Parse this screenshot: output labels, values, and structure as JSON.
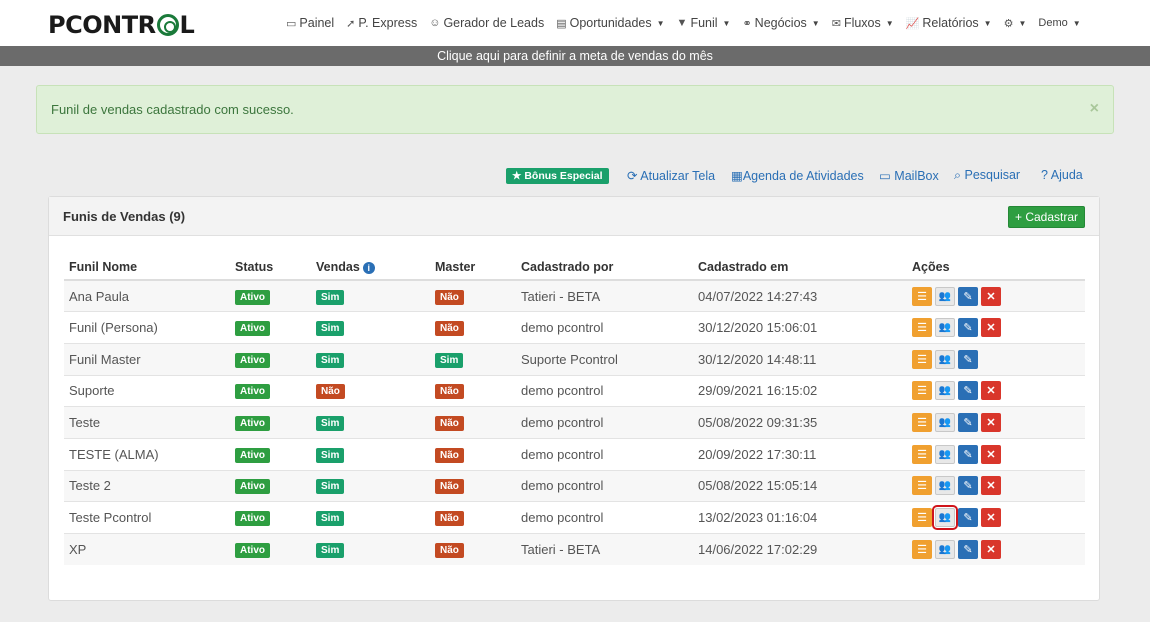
{
  "app": {
    "logo": "PCONTROL"
  },
  "nav": [
    {
      "label": "Painel",
      "icon": "monitor-icon",
      "caret": false
    },
    {
      "label": "P. Express",
      "icon": "rocket-icon",
      "caret": false
    },
    {
      "label": "Gerador de Leads",
      "icon": "robot-icon",
      "caret": false
    },
    {
      "label": "Oportunidades",
      "icon": "list-icon",
      "caret": true
    },
    {
      "label": "Funil",
      "icon": "filter-icon",
      "caret": true
    },
    {
      "label": "Negócios",
      "icon": "handshake-icon",
      "caret": true
    },
    {
      "label": "Fluxos",
      "icon": "envelope-icon",
      "caret": true
    },
    {
      "label": "Relatórios",
      "icon": "chart-icon",
      "caret": true
    }
  ],
  "user": {
    "label": "Demo"
  },
  "goal_bar": "Clique aqui para definir a meta de vendas do mês",
  "alert": {
    "message": "Funil de vendas cadastrado com sucesso.",
    "close": "×"
  },
  "quick_links": {
    "bonus": "Bônus Especial",
    "refresh": "Atualizar Tela",
    "agenda": "Agenda de Atividades",
    "mailbox": "MailBox",
    "search": "Pesquisar",
    "help": "Ajuda"
  },
  "panel": {
    "title": "Funis de Vendas (9)",
    "add_button": "Cadastrar"
  },
  "table": {
    "headers": [
      "Funil Nome",
      "Status",
      "Vendas",
      "Master",
      "Cadastrado por",
      "Cadastrado em",
      "Ações"
    ],
    "rows": [
      {
        "name": "Ana Paula",
        "status": "Ativo",
        "vendas": "Sim",
        "master": "Não",
        "by": "Tatieri - BETA",
        "at": "04/07/2022 14:27:43",
        "deletable": true
      },
      {
        "name": "Funil (Persona)",
        "status": "Ativo",
        "vendas": "Sim",
        "master": "Não",
        "by": "demo pcontrol",
        "at": "30/12/2020 15:06:01",
        "deletable": true
      },
      {
        "name": "Funil Master",
        "status": "Ativo",
        "vendas": "Sim",
        "master": "Sim",
        "by": "Suporte Pcontrol",
        "at": "30/12/2020 14:48:11",
        "deletable": false
      },
      {
        "name": "Suporte",
        "status": "Ativo",
        "vendas": "Não",
        "master": "Não",
        "by": "demo pcontrol",
        "at": "29/09/2021 16:15:02",
        "deletable": true
      },
      {
        "name": "Teste",
        "status": "Ativo",
        "vendas": "Sim",
        "master": "Não",
        "by": "demo pcontrol",
        "at": "05/08/2022 09:31:35",
        "deletable": true
      },
      {
        "name": "TESTE (ALMA)",
        "status": "Ativo",
        "vendas": "Sim",
        "master": "Não",
        "by": "demo pcontrol",
        "at": "20/09/2022 17:30:11",
        "deletable": true
      },
      {
        "name": "Teste 2",
        "status": "Ativo",
        "vendas": "Sim",
        "master": "Não",
        "by": "demo pcontrol",
        "at": "05/08/2022 15:05:14",
        "deletable": true
      },
      {
        "name": "Teste Pcontrol",
        "status": "Ativo",
        "vendas": "Sim",
        "master": "Não",
        "by": "demo pcontrol",
        "at": "13/02/2023 01:16:04",
        "deletable": true,
        "highlight_team": true
      },
      {
        "name": "XP",
        "status": "Ativo",
        "vendas": "Sim",
        "master": "Não",
        "by": "Tatieri - BETA",
        "at": "14/06/2022 17:02:29",
        "deletable": true
      }
    ]
  },
  "colors": {
    "green": "#2e9e41",
    "teal": "#1aa06b",
    "red": "#c34a22",
    "blue": "#2a6fb5",
    "orange": "#f0a030",
    "highlight": "#d0141b"
  }
}
